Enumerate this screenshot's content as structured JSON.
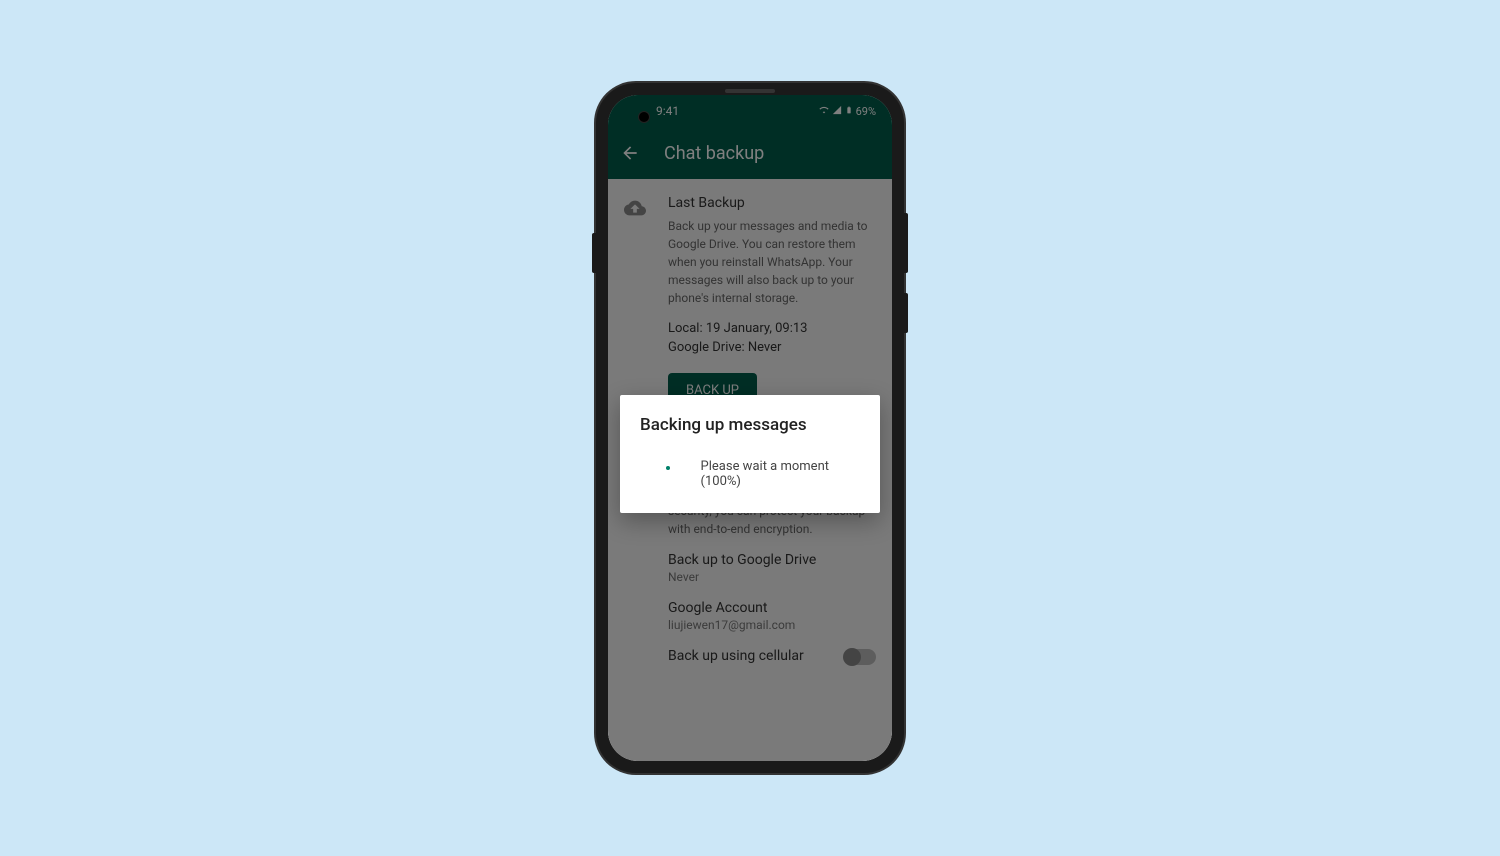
{
  "status_bar": {
    "time": "9:41",
    "battery": "69%"
  },
  "app_bar": {
    "title": "Chat backup"
  },
  "last_backup": {
    "title": "Last Backup",
    "description": "Back up your messages and media to Google Drive. You can restore them when you reinstall WhatsApp. Your messages will also back up to your phone's internal storage.",
    "local_line": "Local: 19 January, 09:13",
    "gdrive_line": "Google Drive: Never",
    "button_label": "BACK UP"
  },
  "gdrive_settings": {
    "description": "Back up your chat history and media to Google Drive so if you change phones, your chat history is safe. For added security, you can protect your backup with end-to-end encryption.",
    "backup_to": {
      "title": "Back up to Google Drive",
      "value": "Never"
    },
    "account": {
      "title": "Google Account",
      "value": "liujiewen17@gmail.com"
    },
    "cellular": {
      "title": "Back up using cellular"
    }
  },
  "dialog": {
    "title": "Backing up messages",
    "text": "Please wait a moment (100%)"
  }
}
